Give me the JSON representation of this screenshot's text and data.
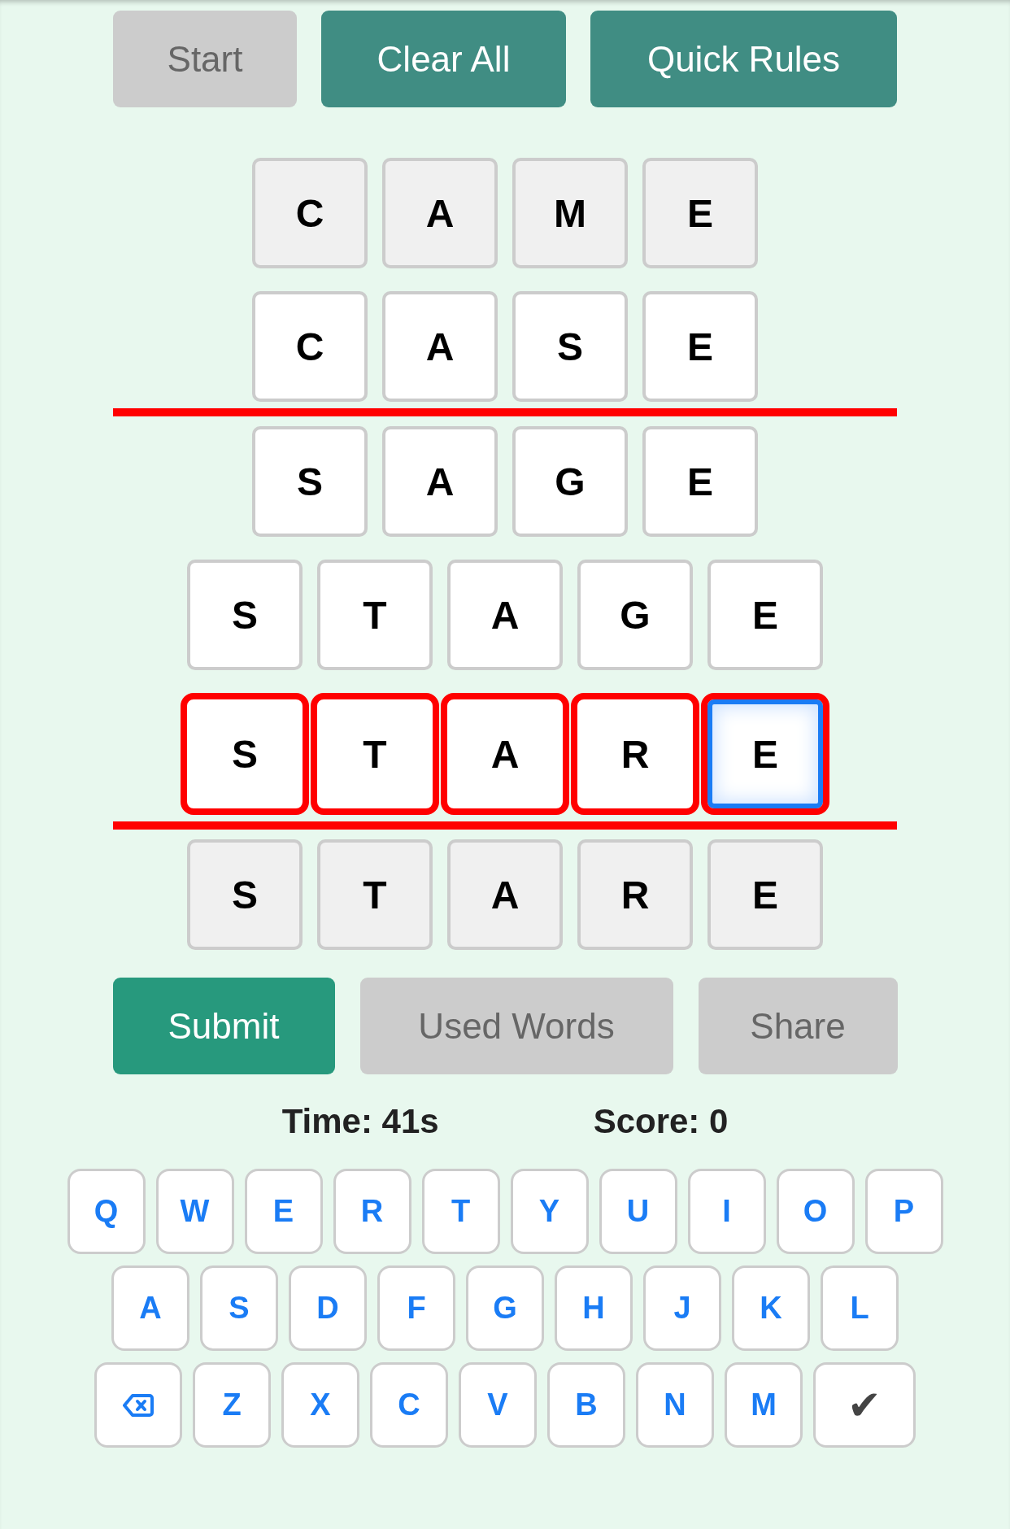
{
  "top_buttons": [
    {
      "label": "Start",
      "disabled": true
    },
    {
      "label": "Clear All",
      "disabled": false
    },
    {
      "label": "Quick Rules",
      "disabled": false
    }
  ],
  "board": [
    {
      "kind": "given_row",
      "active": false,
      "tiles": [
        {
          "letter": "C",
          "selected": false
        },
        {
          "letter": "A",
          "selected": false
        },
        {
          "letter": "M",
          "selected": false
        },
        {
          "letter": "E",
          "selected": false
        }
      ]
    },
    {
      "kind": "entry_row",
      "active": false,
      "tiles": [
        {
          "letter": "C",
          "selected": false
        },
        {
          "letter": "A",
          "selected": false
        },
        {
          "letter": "S",
          "selected": false
        },
        {
          "letter": "E",
          "selected": false
        }
      ]
    },
    {
      "kind": "divider"
    },
    {
      "kind": "entry_row",
      "active": false,
      "tiles": [
        {
          "letter": "S",
          "selected": false
        },
        {
          "letter": "A",
          "selected": false
        },
        {
          "letter": "G",
          "selected": false
        },
        {
          "letter": "E",
          "selected": false
        }
      ]
    },
    {
      "kind": "entry_row",
      "active": false,
      "tiles": [
        {
          "letter": "S",
          "selected": false
        },
        {
          "letter": "T",
          "selected": false
        },
        {
          "letter": "A",
          "selected": false
        },
        {
          "letter": "G",
          "selected": false
        },
        {
          "letter": "E",
          "selected": false
        }
      ]
    },
    {
      "kind": "entry_row",
      "active": true,
      "tiles": [
        {
          "letter": "S",
          "selected": false
        },
        {
          "letter": "T",
          "selected": false
        },
        {
          "letter": "A",
          "selected": false
        },
        {
          "letter": "R",
          "selected": false
        },
        {
          "letter": "E",
          "selected": true
        }
      ]
    },
    {
      "kind": "divider"
    },
    {
      "kind": "given_row",
      "active": false,
      "tiles": [
        {
          "letter": "S",
          "selected": false
        },
        {
          "letter": "T",
          "selected": false
        },
        {
          "letter": "A",
          "selected": false
        },
        {
          "letter": "R",
          "selected": false
        },
        {
          "letter": "E",
          "selected": false
        }
      ]
    }
  ],
  "action_buttons": [
    {
      "label": "Submit",
      "disabled": false
    },
    {
      "label": "Used Words",
      "disabled": true
    },
    {
      "label": "Share",
      "disabled": true
    }
  ],
  "stats": [
    "Time: 41s",
    "Score: 0"
  ],
  "keyboard": [
    [
      {
        "kind": "letter",
        "label": "Q"
      },
      {
        "kind": "letter",
        "label": "W"
      },
      {
        "kind": "letter",
        "label": "E"
      },
      {
        "kind": "letter",
        "label": "R"
      },
      {
        "kind": "letter",
        "label": "T"
      },
      {
        "kind": "letter",
        "label": "Y"
      },
      {
        "kind": "letter",
        "label": "U"
      },
      {
        "kind": "letter",
        "label": "I"
      },
      {
        "kind": "letter",
        "label": "O"
      },
      {
        "kind": "letter",
        "label": "P"
      }
    ],
    [
      {
        "kind": "letter",
        "label": "A"
      },
      {
        "kind": "letter",
        "label": "S"
      },
      {
        "kind": "letter",
        "label": "D"
      },
      {
        "kind": "letter",
        "label": "F"
      },
      {
        "kind": "letter",
        "label": "G"
      },
      {
        "kind": "letter",
        "label": "H"
      },
      {
        "kind": "letter",
        "label": "J"
      },
      {
        "kind": "letter",
        "label": "K"
      },
      {
        "kind": "letter",
        "label": "L"
      }
    ],
    [
      {
        "kind": "backspace"
      },
      {
        "kind": "letter",
        "label": "Z"
      },
      {
        "kind": "letter",
        "label": "X"
      },
      {
        "kind": "letter",
        "label": "C"
      },
      {
        "kind": "letter",
        "label": "V"
      },
      {
        "kind": "letter",
        "label": "B"
      },
      {
        "kind": "letter",
        "label": "N"
      },
      {
        "kind": "letter",
        "label": "M"
      },
      {
        "kind": "enter",
        "label": "✔"
      }
    ]
  ]
}
